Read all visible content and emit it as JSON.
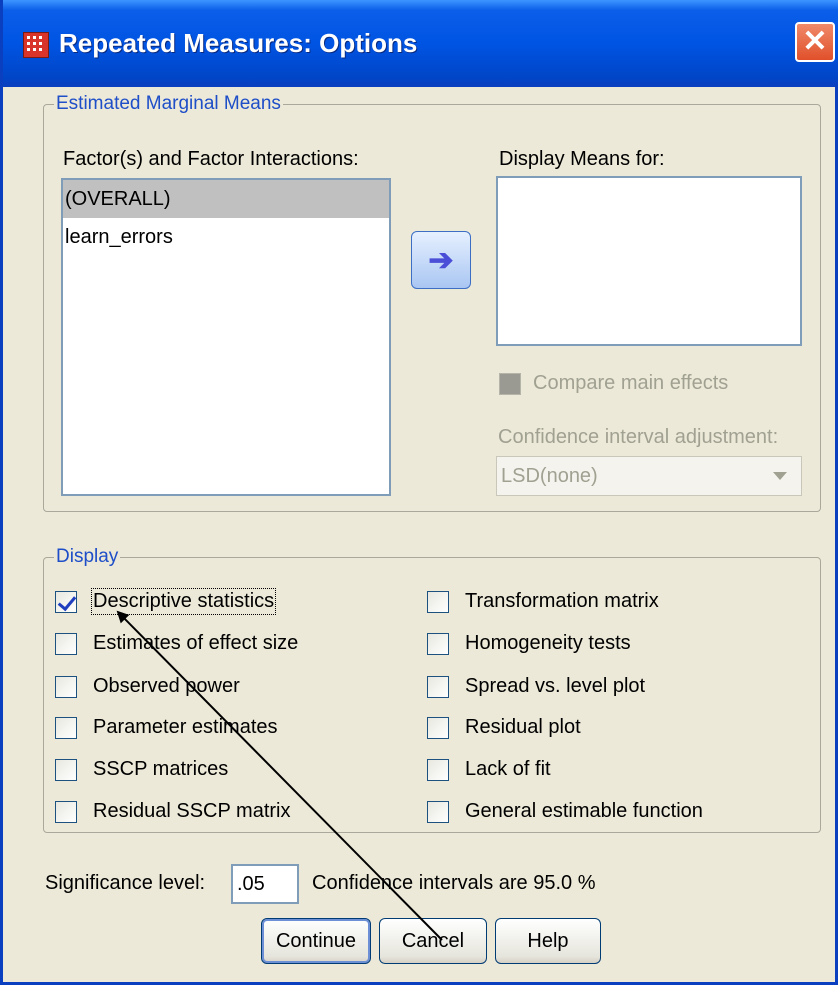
{
  "window": {
    "title": "Repeated Measures: Options",
    "close_glyph": "✕",
    "icon": "spss-grid-icon"
  },
  "emm": {
    "legend": "Estimated Marginal Means",
    "factors_label": "Factor(s) and Factor Interactions:",
    "factors": [
      "(OVERALL)",
      "learn_errors"
    ],
    "selected_factor": "(OVERALL)",
    "display_means_label": "Display Means for:",
    "display_means_items": [],
    "move_button_glyph": "➔",
    "compare_main_effects_label": "Compare main effects",
    "compare_main_effects_checked": false,
    "ci_adjustment_label": "Confidence interval adjustment:",
    "ci_adjustment_value": "LSD(none)"
  },
  "display": {
    "legend": "Display",
    "left": [
      {
        "label": "Descriptive statistics",
        "checked": true
      },
      {
        "label": "Estimates of effect size",
        "checked": false
      },
      {
        "label": "Observed power",
        "checked": false
      },
      {
        "label": "Parameter estimates",
        "checked": false
      },
      {
        "label": "SSCP matrices",
        "checked": false
      },
      {
        "label": "Residual SSCP matrix",
        "checked": false
      }
    ],
    "right": [
      {
        "label": "Transformation matrix",
        "checked": false
      },
      {
        "label": "Homogeneity tests",
        "checked": false
      },
      {
        "label": "Spread vs. level plot",
        "checked": false
      },
      {
        "label": "Residual plot",
        "checked": false
      },
      {
        "label": "Lack of fit",
        "checked": false
      },
      {
        "label": "General estimable function",
        "checked": false
      }
    ]
  },
  "significance": {
    "label": "Significance level:",
    "value": ".05",
    "ci_text": "Confidence intervals are 95.0 %"
  },
  "buttons": {
    "continue": "Continue",
    "cancel": "Cancel",
    "help": "Help"
  },
  "colors": {
    "titlebar": "#0054e3",
    "dialog_bg": "#ece9d8",
    "legend_text": "#1e4ec8",
    "selection": "#c0c0c0",
    "check_mark": "#1f3fbf"
  }
}
